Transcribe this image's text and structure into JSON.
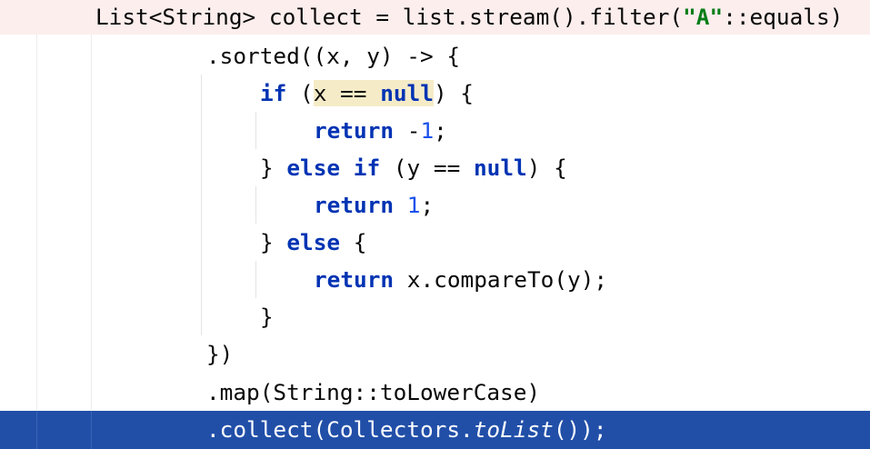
{
  "editor": {
    "lines": [
      {
        "indent": "    ",
        "segments": [
          {
            "t": "List<String> collect = list.stream().filter(",
            "c": "plain"
          },
          {
            "t": "\"A\"",
            "c": "str"
          },
          {
            "t": "::equals)",
            "c": "plain"
          }
        ]
      },
      {
        "indent": "        ",
        "segments": [
          {
            "t": ".sorted((x, y) -> {",
            "c": "plain"
          }
        ]
      },
      {
        "indent": "            ",
        "segments": [
          {
            "t": "if",
            "c": "kw"
          },
          {
            "t": " (",
            "c": "plain"
          },
          {
            "t": "x == ",
            "c": "hl"
          },
          {
            "t": "null",
            "c": "kw hl"
          },
          {
            "t": ") {",
            "c": "plain"
          }
        ]
      },
      {
        "indent": "                ",
        "segments": [
          {
            "t": "return",
            "c": "kw"
          },
          {
            "t": " -",
            "c": "plain"
          },
          {
            "t": "1",
            "c": "num"
          },
          {
            "t": ";",
            "c": "plain"
          }
        ]
      },
      {
        "indent": "            ",
        "segments": [
          {
            "t": "} ",
            "c": "plain"
          },
          {
            "t": "else if",
            "c": "kw"
          },
          {
            "t": " (y == ",
            "c": "plain"
          },
          {
            "t": "null",
            "c": "kw"
          },
          {
            "t": ") {",
            "c": "plain"
          }
        ]
      },
      {
        "indent": "                ",
        "segments": [
          {
            "t": "return",
            "c": "kw"
          },
          {
            "t": " ",
            "c": "plain"
          },
          {
            "t": "1",
            "c": "num"
          },
          {
            "t": ";",
            "c": "plain"
          }
        ]
      },
      {
        "indent": "            ",
        "segments": [
          {
            "t": "} ",
            "c": "plain"
          },
          {
            "t": "else",
            "c": "kw"
          },
          {
            "t": " {",
            "c": "plain"
          }
        ]
      },
      {
        "indent": "                ",
        "segments": [
          {
            "t": "return",
            "c": "kw"
          },
          {
            "t": " x.compareTo(y);",
            "c": "plain"
          }
        ]
      },
      {
        "indent": "            ",
        "segments": [
          {
            "t": "}",
            "c": "plain"
          }
        ]
      },
      {
        "indent": "        ",
        "segments": [
          {
            "t": "})",
            "c": "plain"
          }
        ]
      },
      {
        "indent": "        ",
        "segments": [
          {
            "t": ".map(String::toLowerCase)",
            "c": "plain"
          }
        ]
      },
      {
        "indent": "        ",
        "segments": [
          {
            "t": ".collect(Collectors.",
            "c": "plain"
          },
          {
            "t": "toList",
            "c": "italic"
          },
          {
            "t": "());",
            "c": "plain"
          }
        ]
      }
    ],
    "colors": {
      "keyword": "#0033b3",
      "string": "#067d17",
      "number": "#1750eb",
      "selection": "#214fa8",
      "changed_line": "#fbeeed",
      "highlight": "#f5ebc7"
    }
  }
}
